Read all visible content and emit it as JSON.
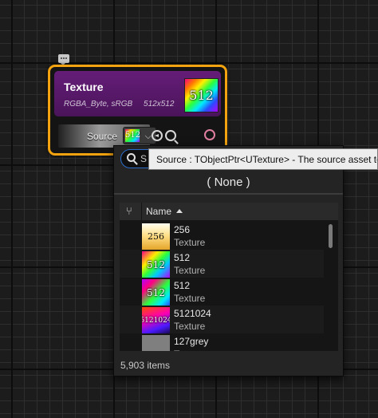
{
  "node": {
    "title": "Texture",
    "subtitle": "RGBA_Byte, sRGB     512x512",
    "thumb_label": "512",
    "pin_label": "Source",
    "pin_value": "512",
    "accent_color": "#f2a30f",
    "header_color": "#651d78"
  },
  "dropdown": {
    "search_value": "S",
    "none_label": "( None )",
    "column_name": "Name",
    "assets": [
      {
        "thumb": "256",
        "name": "256",
        "type": "Texture"
      },
      {
        "thumb": "512",
        "name": "512",
        "type": "Texture"
      },
      {
        "thumb": "512",
        "name": "512",
        "type": "Texture"
      },
      {
        "thumb": "5121024",
        "name": "5121024",
        "type": "Texture"
      },
      {
        "thumb": "",
        "name": "127grey",
        "type": "Texture"
      }
    ],
    "item_count": "5,903 items",
    "focus_color": "#2b6dc9"
  },
  "tooltip": {
    "text": "Source : TObjectPtr<UTexture> - The source asset to be"
  },
  "icons": {
    "comment": "comment-bubble-icon",
    "use_selected": "use-selected-arrow-icon",
    "browse": "browse-magnifier-icon",
    "search": "search-icon",
    "branch": "branch-filter-icon",
    "sort": "sort-ascending-icon"
  }
}
